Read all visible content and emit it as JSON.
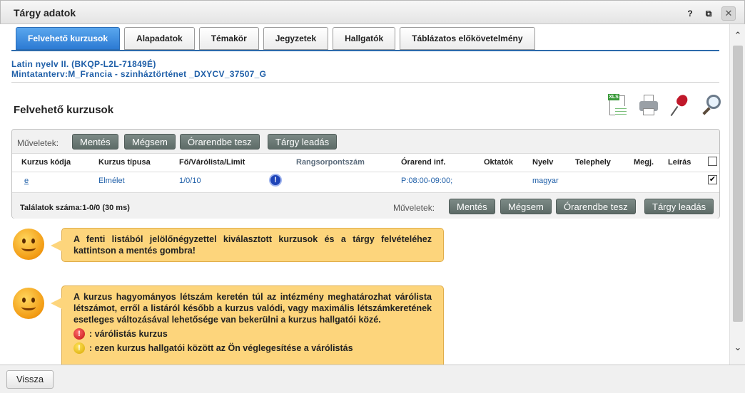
{
  "window": {
    "title": "Tárgy adatok",
    "help_glyph": "?",
    "popout_glyph": "⧉",
    "close_glyph": "✕"
  },
  "tabs": [
    {
      "label": "Felvehető kurzusok",
      "active": true
    },
    {
      "label": "Alapadatok",
      "active": false
    },
    {
      "label": "Témakör",
      "active": false
    },
    {
      "label": "Jegyzetek",
      "active": false
    },
    {
      "label": "Hallgatók",
      "active": false
    },
    {
      "label": "Táblázatos előkövetelmény",
      "active": false
    }
  ],
  "course_info": {
    "line1": "Latin nyelv II. (BKQP-L2L-71849É)",
    "line2": "Mintatanterv:M_Francia - szinháztörténet _DXYCV_37507_G"
  },
  "section_title": "Felvehető kurzusok",
  "tool_icons": [
    "excel-export-icon",
    "printer-icon",
    "pin-icon",
    "magnifier-icon"
  ],
  "operations": {
    "label": "Műveletek:",
    "save": "Mentés",
    "cancel": "Mégsem",
    "add_to_timetable": "Órarendbe tesz",
    "drop_subject": "Tárgy leadás"
  },
  "table": {
    "columns": [
      "Kurzus kódja",
      "Kurzus típusa",
      "Fő/Várólista/Limit",
      "Rangsorpontszám",
      "Órarend inf.",
      "Oktatók",
      "Nyelv",
      "Telephely",
      "Megj.",
      "Leírás"
    ],
    "rows": [
      {
        "code": "e",
        "type": "Elmélet",
        "capacity": "1/0/10",
        "info_glyph": "!",
        "rank": "",
        "timetable": "P:08:00-09:00;",
        "teachers": "",
        "language": "magyar",
        "site": "",
        "note": "",
        "checked": true
      }
    ],
    "header_checked": false,
    "results": "Találatok száma:1-0/0 (30 ms)"
  },
  "tips": {
    "tip1": "A fenti listából jelölőnégyzettel kiválasztott kurzusok és a tárgy felvételéhez kattintson a mentés gombra!",
    "tip2": "A kurzus hagyományos létszám keretén túl az intézmény meghatározhat várólista létszámot, erről a listáról később a kurzus valódi, vagy maximális létszámkeretének esetleges változásával lehetősége van bekerülni a kurzus hallgatói közé.",
    "legend_red": ": várólistás kurzus",
    "legend_yellow": ": ezen kurzus hallgatói között az Ön véglegesítése a várólistás",
    "legend_glyph": "!"
  },
  "footer": {
    "back": "Vissza"
  },
  "scroll": {
    "up_glyph": "⌃",
    "down_glyph": "⌄"
  }
}
